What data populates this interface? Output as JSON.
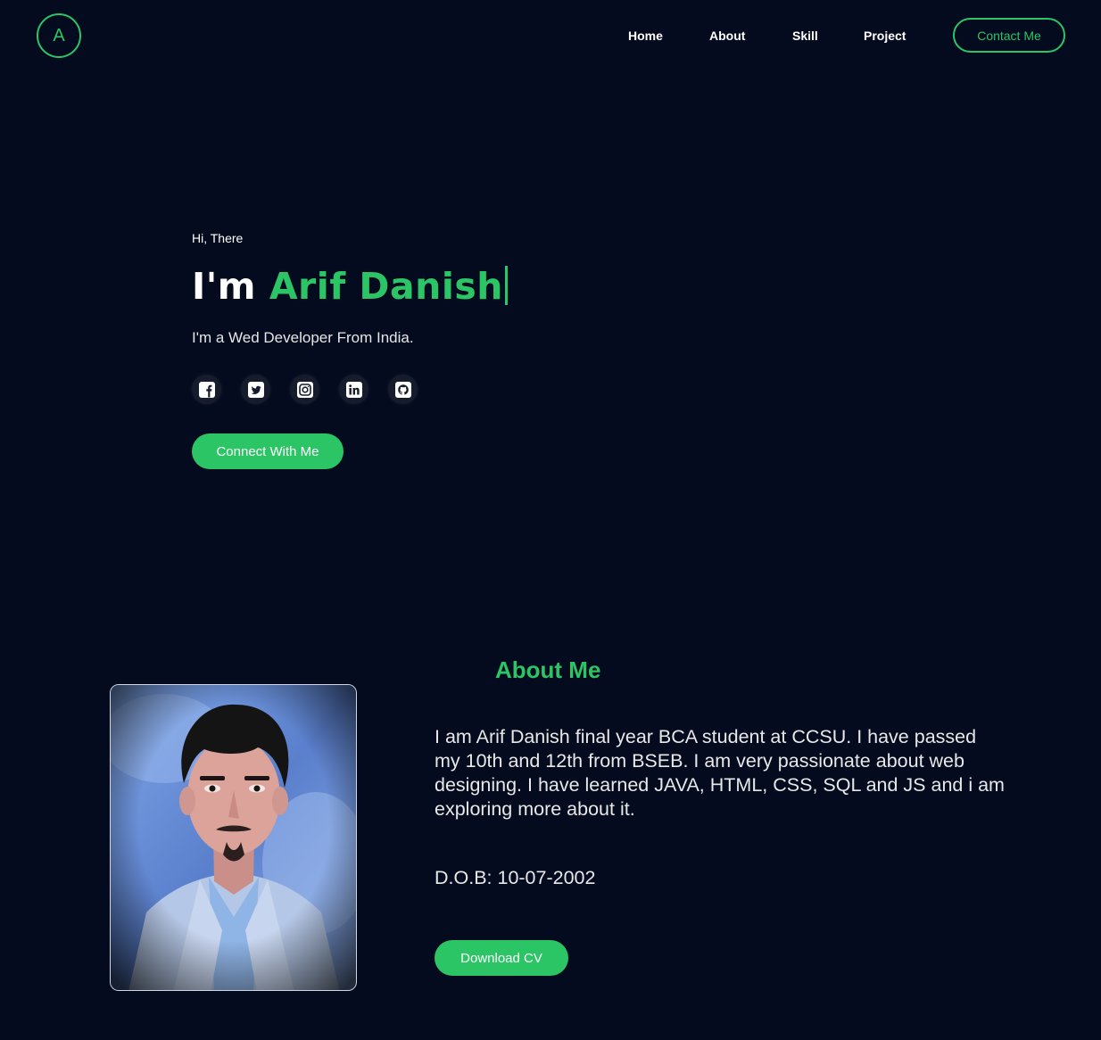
{
  "nav": {
    "logo_letter": "A",
    "links": [
      "Home",
      "About",
      "Skill",
      "Project"
    ],
    "contact_label": "Contact Me"
  },
  "hero": {
    "greeting": "Hi, There",
    "headline_prefix": "I'm",
    "name": "Arif Danish",
    "tagline": "I'm a Wed Developer From India.",
    "socials": [
      "facebook-icon",
      "twitter-icon",
      "instagram-icon",
      "linkedin-icon",
      "github-icon"
    ],
    "connect_label": "Connect With Me"
  },
  "about": {
    "title": "About Me",
    "description": "I am Arif Danish final year BCA student at CCSU. I have passed my 10th and 12th from BSEB. I am very passionate about web designing. I have learned JAVA, HTML, CSS, SQL and JS and i am exploring more about it.",
    "dob": "D.O.B: 10-07-2002",
    "download_label": "Download CV"
  },
  "colors": {
    "background": "#040b1e",
    "accent": "#2bc566",
    "text": "#ffffff"
  }
}
